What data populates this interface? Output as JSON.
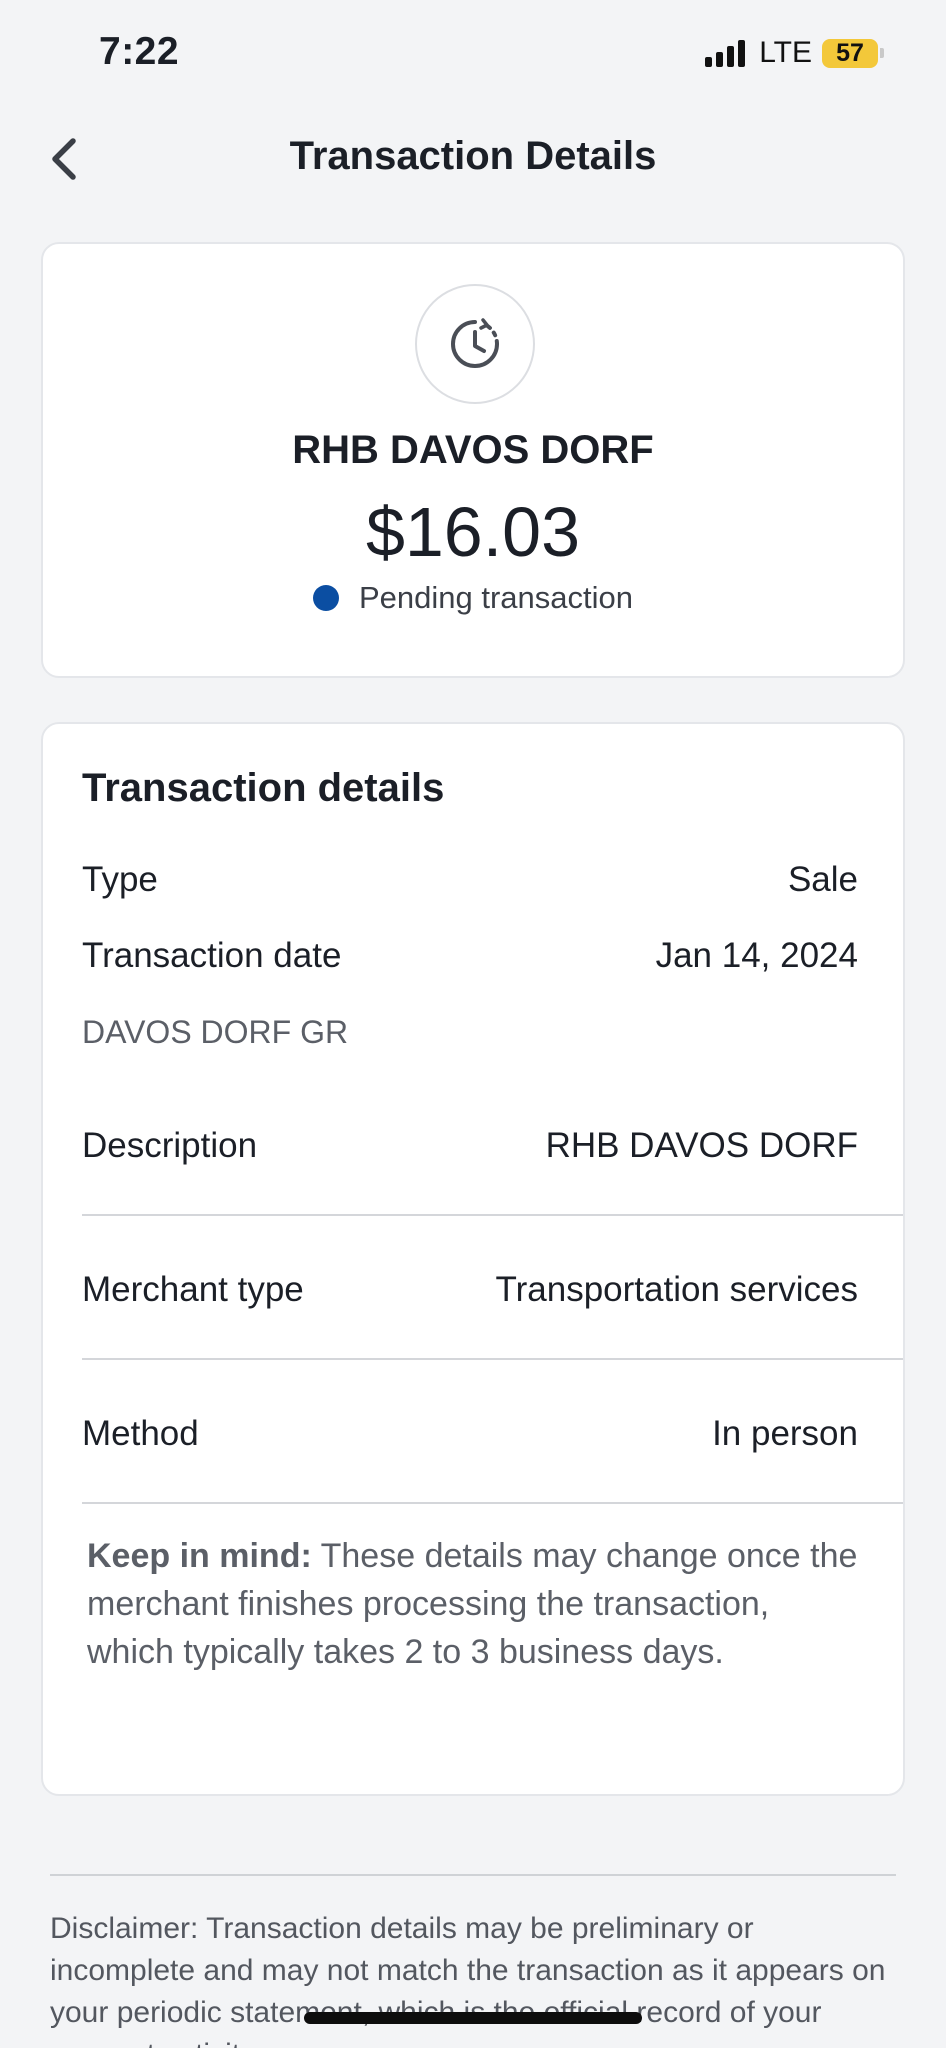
{
  "status_bar": {
    "time": "7:22",
    "network": "LTE",
    "battery": "57"
  },
  "header": {
    "title": "Transaction Details"
  },
  "summary": {
    "merchant": "RHB DAVOS DORF",
    "amount": "$16.03",
    "status": "Pending transaction",
    "status_color": "#0b4ea2",
    "icon": "pending-clock-icon"
  },
  "details": {
    "heading": "Transaction details",
    "type_label": "Type",
    "type_value": "Sale",
    "date_label": "Transaction date",
    "date_value": "Jan 14, 2024",
    "location": "DAVOS DORF GR",
    "description_label": "Description",
    "description_value": "RHB DAVOS DORF",
    "merchant_type_label": "Merchant type",
    "merchant_type_value": "Transportation services",
    "method_label": "Method",
    "method_value": "In person",
    "note_bold": "Keep in mind:",
    "note_text": " These details may change once the merchant finishes processing the transaction, which typically takes 2 to 3 business days."
  },
  "disclaimer": "Disclaimer: Transaction details may be preliminary or incomplete and may not match the transaction as it appears on your periodic statement, which is the official record of your account activity."
}
